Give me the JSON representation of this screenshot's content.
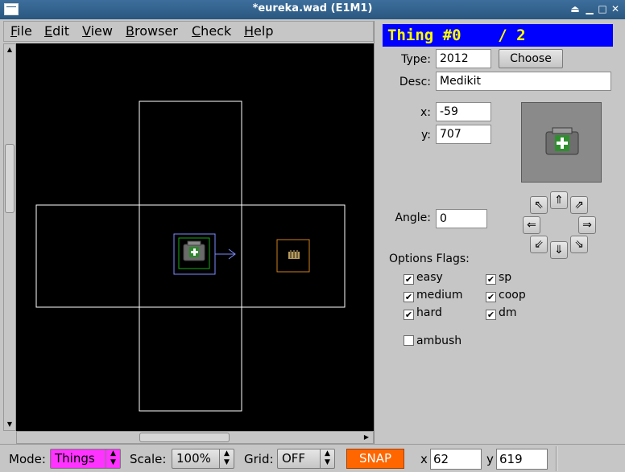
{
  "window": {
    "title": "*eureka.wad (E1M1)",
    "controls": {
      "shade": "⏏",
      "minimize": "▁",
      "maximize": "□",
      "close": "✕"
    }
  },
  "menu": [
    {
      "label": "File",
      "u": "F",
      "rest": "ile"
    },
    {
      "label": "Edit",
      "u": "E",
      "rest": "dit"
    },
    {
      "label": "View",
      "u": "V",
      "rest": "iew"
    },
    {
      "label": "Browser",
      "u": "B",
      "rest": "rowser"
    },
    {
      "label": "Check",
      "u": "C",
      "rest": "heck"
    },
    {
      "label": "Help",
      "u": "H",
      "rest": "elp"
    }
  ],
  "panel": {
    "header": "Thing #0    / 2",
    "type_label": "Type:",
    "type_value": "2012",
    "choose_label": "Choose",
    "desc_label": "Desc:",
    "desc_value": "Medikit",
    "x_label": "x:",
    "x_value": "-59",
    "y_label": "y:",
    "y_value": "707",
    "angle_label": "Angle:",
    "angle_value": "0",
    "options_label": "Options Flags:",
    "flags": {
      "easy": {
        "label": "easy",
        "checked": true
      },
      "medium": {
        "label": "medium",
        "checked": true
      },
      "hard": {
        "label": "hard",
        "checked": true
      },
      "sp": {
        "label": "sp",
        "checked": true
      },
      "coop": {
        "label": "coop",
        "checked": true
      },
      "dm": {
        "label": "dm",
        "checked": true
      },
      "ambush": {
        "label": "ambush",
        "checked": false
      }
    },
    "directions": {
      "up_left": "⇖",
      "up": "⇑",
      "up_right": "⇗",
      "left": "⇐",
      "right": "⇒",
      "down_left": "⇙",
      "down": "⇓",
      "down_right": "⇘"
    }
  },
  "statusbar": {
    "mode_label": "Mode:",
    "mode_value": "Things",
    "scale_label": "Scale:",
    "scale_value": "100%",
    "grid_label": "Grid:",
    "grid_value": "OFF",
    "snap_label": "SNAP",
    "x_label": "x",
    "x_value": "62",
    "y_label": "y",
    "y_value": "619"
  },
  "colors": {
    "map_background": "#000000",
    "linedef": "#ffffff",
    "selection": "#7d8cff",
    "thing_box": "#18a818",
    "other_thing_box": "#d08020",
    "header_bg": "#0000ff",
    "header_fg": "#ffff00",
    "mode_bg": "#ff33ff",
    "snap_bg": "#ff6600"
  }
}
